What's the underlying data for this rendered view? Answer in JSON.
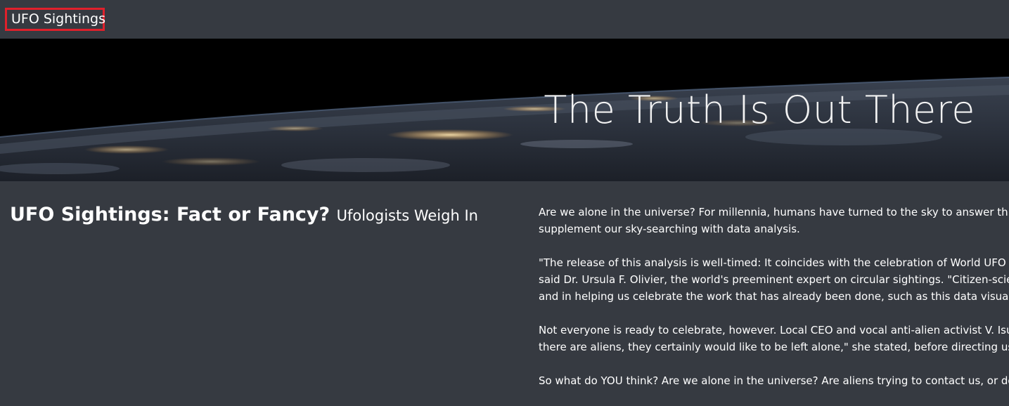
{
  "navbar": {
    "brand": "UFO Sightings"
  },
  "hero": {
    "title": "The Truth Is Out There"
  },
  "article": {
    "headline": "UFO Sightings: Fact or Fancy?",
    "subheadline": "Ufologists Weigh In",
    "paragraphs": [
      [
        "Are we alone in the universe? For millennia, humans have turned to the sky to answer this ques",
        "supplement our sky-searching with data analysis."
      ],
      [
        "\"The release of this analysis is well-timed: It coincides with the celebration of World UFO Day, w",
        "said Dr. Ursula F. Olivier, the world's preeminent expert on circular sightings. \"Citizen-scientists",
        "and in helping us celebrate the work that has already been done, such as this data visualization"
      ],
      [
        "Not everyone is ready to celebrate, however. Local CEO and vocal anti-alien activist V. Isualize r",
        "there are aliens, they certainly would like to be left alone,\" she stated, before directing us to the"
      ],
      [
        "So what do YOU think? Are we alone in the universe? Are aliens trying to contact us, or do they"
      ]
    ]
  },
  "colors": {
    "background": "#363a41",
    "brand_border": "#e0202b",
    "text": "#ffffff"
  }
}
